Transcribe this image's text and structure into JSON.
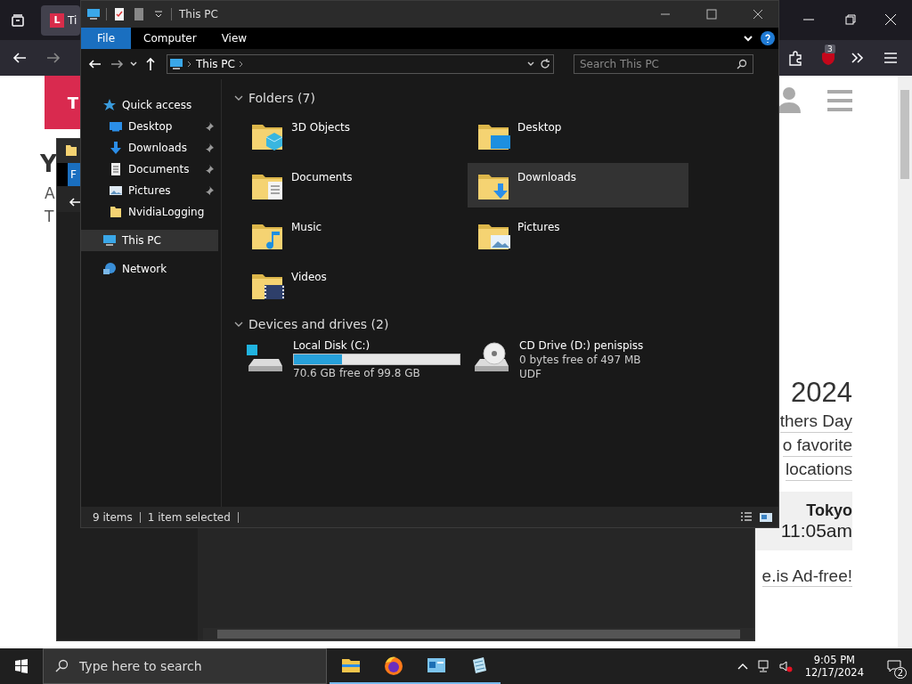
{
  "browser": {
    "tab": {
      "favicon": "L",
      "title": "Ti"
    },
    "toolbar": {
      "badge": "3"
    },
    "page": {
      "banner": "T",
      "heading": "Y",
      "lines": [
        "A",
        "T"
      ],
      "year": "2024",
      "links": [
        "thers Day",
        "o favorite",
        "locations"
      ],
      "card": {
        "city": "Tokyo",
        "time": "11:05am"
      },
      "footer_link": "e.is Ad-free!"
    }
  },
  "back_window": {
    "ribbon_tab": "F"
  },
  "explorer": {
    "title": "This PC",
    "ribbon_tabs": [
      {
        "label": "File",
        "selected": true
      },
      {
        "label": "Computer",
        "selected": false
      },
      {
        "label": "View",
        "selected": false
      }
    ],
    "address": "This PC",
    "search": {
      "placeholder": "Search This PC"
    },
    "nav": [
      {
        "label": "Quick access",
        "kind": "star",
        "selected": false,
        "children": [
          {
            "label": "Desktop",
            "kind": "desktop",
            "pinned": true,
            "selected": false
          },
          {
            "label": "Downloads",
            "kind": "downloads",
            "pinned": true,
            "selected": false
          },
          {
            "label": "Documents",
            "kind": "documents",
            "pinned": true,
            "selected": false
          },
          {
            "label": "Pictures",
            "kind": "pictures",
            "pinned": true,
            "selected": false
          },
          {
            "label": "NvidiaLogging",
            "kind": "folder",
            "pinned": false,
            "selected": false
          }
        ]
      },
      {
        "label": "This PC",
        "kind": "pc",
        "selected": true
      },
      {
        "label": "Network",
        "kind": "network",
        "selected": false
      }
    ],
    "folders": {
      "header": "Folders (7)",
      "items": [
        {
          "name": "3D Objects",
          "kind": "objects",
          "selected": false
        },
        {
          "name": "Desktop",
          "kind": "desktop",
          "selected": false
        },
        {
          "name": "Documents",
          "kind": "documents",
          "selected": false
        },
        {
          "name": "Downloads",
          "kind": "downloads",
          "selected": true
        },
        {
          "name": "Music",
          "kind": "music",
          "selected": false
        },
        {
          "name": "Pictures",
          "kind": "pictures",
          "selected": false
        },
        {
          "name": "Videos",
          "kind": "videos",
          "selected": false
        }
      ]
    },
    "drives": {
      "header": "Devices and drives (2)",
      "items": [
        {
          "name": "Local Disk (C:)",
          "kind": "disk",
          "level": 0.293,
          "lines": [
            "70.6 GB free of 99.8 GB"
          ]
        },
        {
          "name": "CD Drive (D:) penispiss",
          "kind": "cd",
          "lines": [
            "0 bytes free of 497 MB",
            "UDF"
          ]
        }
      ]
    },
    "status": {
      "count": "9 items",
      "selection": "1 item selected"
    }
  },
  "taskbar": {
    "search": {
      "placeholder": "Type here to search"
    },
    "apps": [
      {
        "kind": "explorer",
        "running": true
      },
      {
        "kind": "firefox",
        "running": true
      },
      {
        "kind": "app",
        "running": true
      },
      {
        "kind": "notepad",
        "running": true
      }
    ],
    "clock": {
      "time": "9:05 PM",
      "date": "12/17/2024"
    },
    "notifications": "2"
  }
}
